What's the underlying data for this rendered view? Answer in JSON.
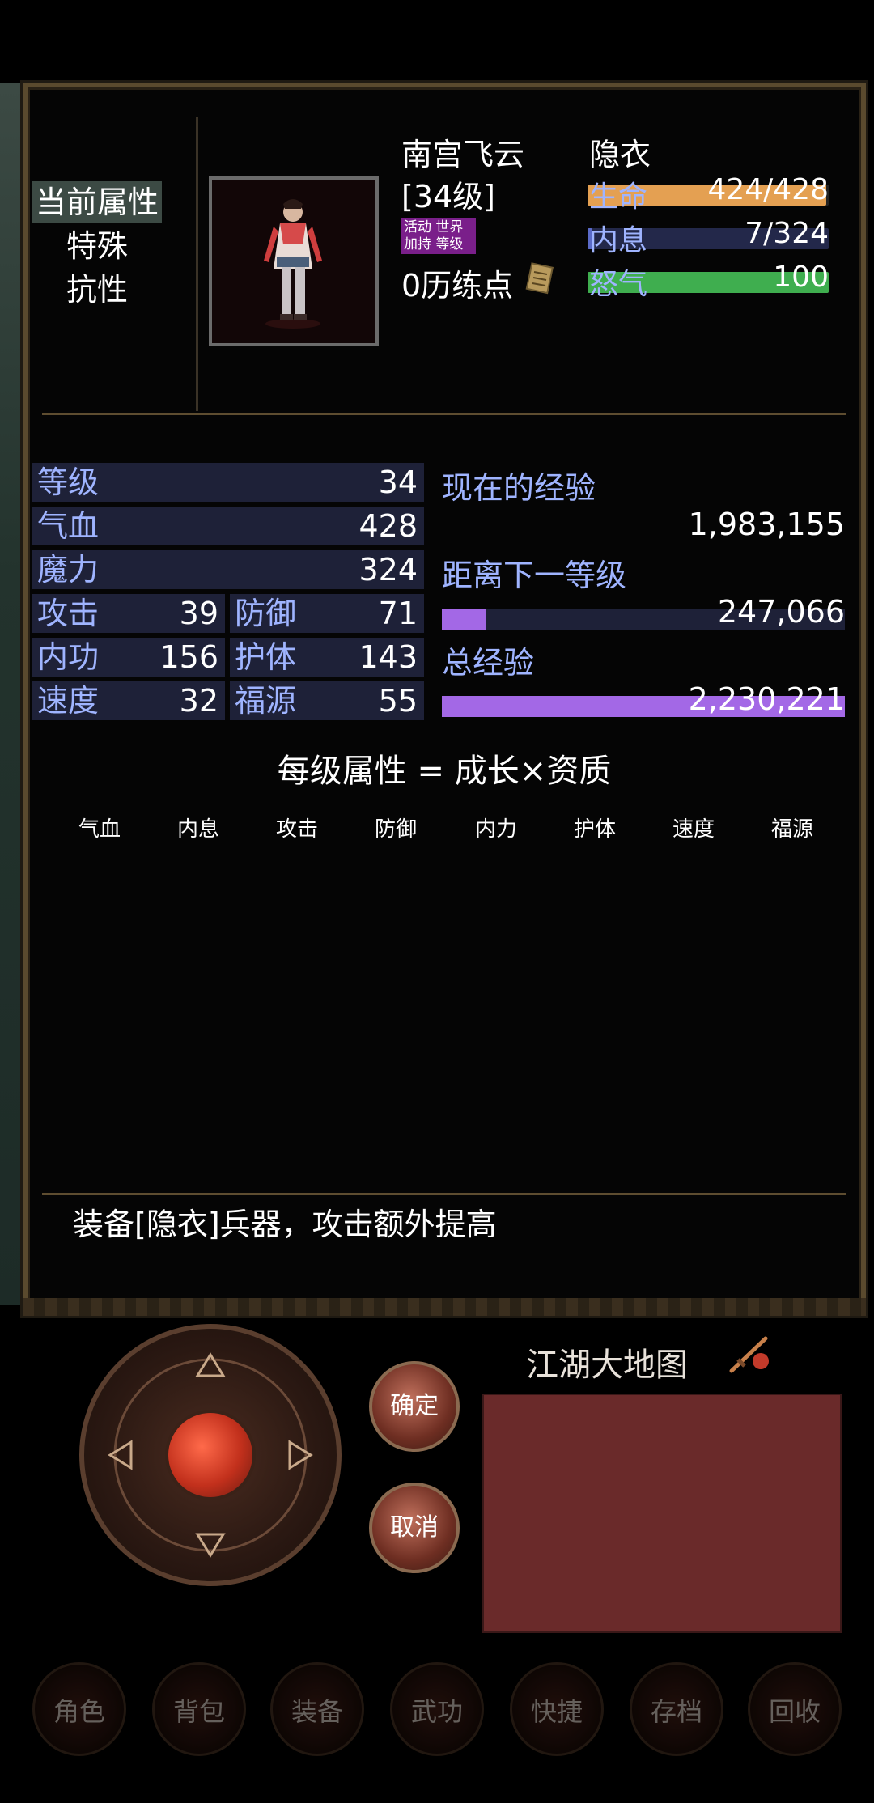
{
  "tabs": [
    {
      "label": "当前属性",
      "active": true
    },
    {
      "label": "特殊",
      "active": false
    },
    {
      "label": "抗性",
      "active": false
    }
  ],
  "character": {
    "name": "南宫飞云",
    "level_badge": "[34级]",
    "title": "隐衣",
    "tag_line1": "活动 世界",
    "tag_line2": "加持 等级",
    "training_points": "0历练点"
  },
  "vitals": {
    "hp_label": "生命",
    "hp_value": "424/428",
    "hp_fraction": 0.99,
    "mp_label": "内息",
    "mp_value": "7/324",
    "mp_fraction": 0.02,
    "rage_label": "怒气",
    "rage_value": "100",
    "rage_fraction": 1.0
  },
  "stats": {
    "level_label": "等级",
    "level": "34",
    "hp_label": "气血",
    "hp": "428",
    "mana_label": "魔力",
    "mana": "324",
    "attack_label": "攻击",
    "attack": "39",
    "defense_label": "防御",
    "defense": "71",
    "inner_label": "内功",
    "inner": "156",
    "guard_label": "护体",
    "guard": "143",
    "speed_label": "速度",
    "speed": "32",
    "luck_label": "福源",
    "luck": "55"
  },
  "experience": {
    "current_label": "现在的经验",
    "current": "1,983,155",
    "next_label": "距离下一等级",
    "next": "247,066",
    "next_fraction": 0.11,
    "total_label": "总经验",
    "total": "2,230,221",
    "total_fraction": 1.0
  },
  "growth": {
    "formula": "每级属性 = 成长×资质",
    "headers": [
      "气血",
      "内息",
      "攻击",
      "防御",
      "内力",
      "护体",
      "速度",
      "福源"
    ]
  },
  "tip": "装备[隐衣]兵器，攻击额外提高",
  "controls": {
    "confirm": "确定",
    "cancel": "取消",
    "map_title": "江湖大地图",
    "menu": [
      "角色",
      "背包",
      "装备",
      "武功",
      "快捷",
      "存档",
      "回收"
    ]
  },
  "colors": {
    "hp_bar": "#e4a052",
    "mp_bar": "#23284a",
    "rage_bar": "#3fae4f",
    "exp_bar": "#a368e6",
    "stat_cell": "#1e2138",
    "label_blue": "#9fb4ff"
  }
}
